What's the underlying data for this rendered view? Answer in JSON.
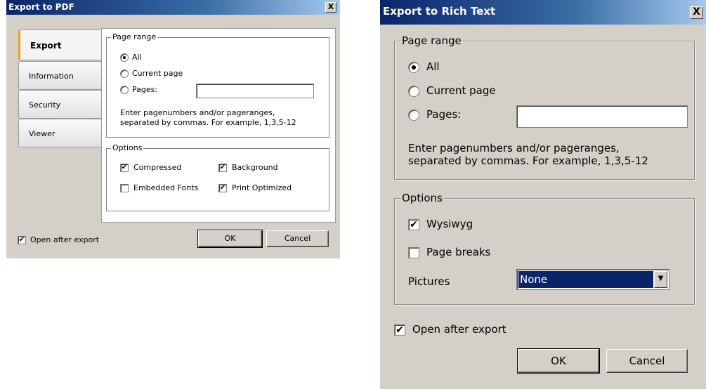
{
  "pdf_dialog": {
    "title": "Export to PDF",
    "close_glyph": "X",
    "tabs": [
      {
        "label": "Export",
        "active": true
      },
      {
        "label": "Information",
        "active": false
      },
      {
        "label": "Security",
        "active": false
      },
      {
        "label": "Viewer",
        "active": false
      }
    ],
    "page_range": {
      "legend": "Page range",
      "all": "All",
      "current": "Current page",
      "pages": "Pages:",
      "pages_value": "",
      "selected": "All",
      "hint_line1": "Enter pagenumbers and/or pageranges,",
      "hint_line2": "separated by commas. For example, 1,3,5-12"
    },
    "options": {
      "legend": "Options",
      "compressed": {
        "label": "Compressed",
        "checked": true
      },
      "background": {
        "label": "Background",
        "checked": true
      },
      "embedded_fonts": {
        "label": "Embedded Fonts",
        "checked": false
      },
      "print_optimized": {
        "label": "Print Optimized",
        "checked": true
      }
    },
    "open_after_export": {
      "label": "Open after export",
      "checked": true
    },
    "ok_label": "OK",
    "cancel_label": "Cancel"
  },
  "rtf_dialog": {
    "title": "Export to Rich Text",
    "close_glyph": "X",
    "page_range": {
      "legend": "Page range",
      "all": "All",
      "current": "Current page",
      "pages": "Pages:",
      "pages_value": "",
      "selected": "All",
      "hint_line1": "Enter pagenumbers and/or pageranges,",
      "hint_line2": "separated by commas. For example, 1,3,5-12"
    },
    "options": {
      "legend": "Options",
      "wysiwyg": {
        "label": "Wysiwyg",
        "checked": true
      },
      "page_breaks": {
        "label": "Page breaks",
        "checked": false
      },
      "pictures_label": "Pictures",
      "pictures_value": "None"
    },
    "open_after_export": {
      "label": "Open after export",
      "checked": true
    },
    "ok_label": "OK",
    "cancel_label": "Cancel"
  },
  "check_glyph": "✔",
  "dropdown_glyph": "▼"
}
